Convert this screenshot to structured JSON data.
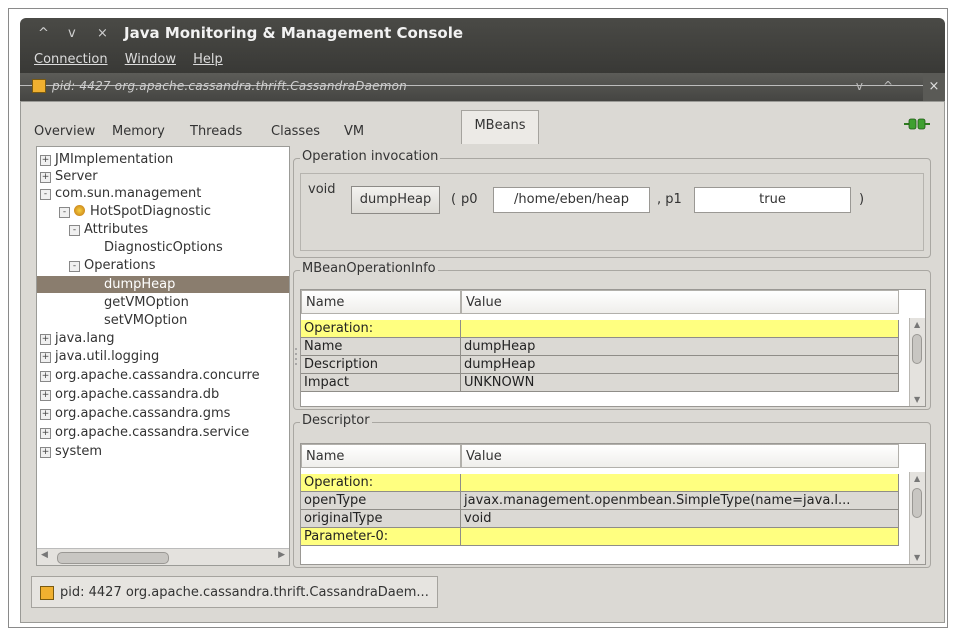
{
  "window": {
    "title": "Java Monitoring & Management Console",
    "controls": [
      "^",
      "v",
      "×"
    ],
    "menu": [
      "Connection",
      "Window",
      "Help"
    ]
  },
  "internal_frame": {
    "title": "pid: 4427 org.apache.cassandra.thrift.CassandraDaemon",
    "controls": [
      "v",
      "^",
      "×"
    ]
  },
  "tabs": [
    "Overview",
    "Memory",
    "Threads",
    "Classes",
    "VM Summary",
    "MBeans"
  ],
  "active_tab": "MBeans",
  "tree": [
    {
      "label": "JMImplementation",
      "expander": "+"
    },
    {
      "label": "Server",
      "expander": "+"
    },
    {
      "label": "com.sun.management",
      "expander": "-"
    },
    {
      "label": "HotSpotDiagnostic",
      "expander": "-"
    },
    {
      "label": "Attributes",
      "expander": "-"
    },
    {
      "label": "DiagnosticOptions",
      "expander": ""
    },
    {
      "label": "Operations",
      "expander": "-"
    },
    {
      "label": "dumpHeap",
      "expander": ""
    },
    {
      "label": "getVMOption",
      "expander": ""
    },
    {
      "label": "setVMOption",
      "expander": ""
    },
    {
      "label": "java.lang",
      "expander": "+"
    },
    {
      "label": "java.util.logging",
      "expander": "+"
    },
    {
      "label": "org.apache.cassandra.concurre",
      "expander": "+"
    },
    {
      "label": "org.apache.cassandra.db",
      "expander": "+"
    },
    {
      "label": "org.apache.cassandra.gms",
      "expander": "+"
    },
    {
      "label": "org.apache.cassandra.service",
      "expander": "+"
    },
    {
      "label": "system",
      "expander": "+"
    }
  ],
  "operation_invocation": {
    "title": "Operation invocation",
    "return_type": "void",
    "method_button": "dumpHeap",
    "open_paren": "(",
    "p0_label": "p0",
    "p0_value": "/home/eben/heap",
    "comma_p1": ", p1",
    "p1_value": "true",
    "close_paren": ")"
  },
  "mbean_info": {
    "title": "MBeanOperationInfo",
    "headers": [
      "Name",
      "Value"
    ],
    "rows": [
      {
        "name": "Operation:",
        "value": "",
        "style": "yellow"
      },
      {
        "name": "Name",
        "value": "dumpHeap",
        "style": "gray"
      },
      {
        "name": "Description",
        "value": "dumpHeap",
        "style": "gray"
      },
      {
        "name": "Impact",
        "value": "UNKNOWN",
        "style": "gray"
      }
    ]
  },
  "descriptor": {
    "title": "Descriptor",
    "headers": [
      "Name",
      "Value"
    ],
    "rows": [
      {
        "name": "Operation:",
        "value": "",
        "style": "yellow"
      },
      {
        "name": "openType",
        "value": "javax.management.openmbean.SimpleType(name=java.l...",
        "style": "gray"
      },
      {
        "name": "originalType",
        "value": "void",
        "style": "gray"
      },
      {
        "name": "Parameter-0:",
        "value": "",
        "style": "yellow"
      }
    ]
  },
  "status_bar": {
    "label": "pid: 4427 org.apache.cassandra.thrift.CassandraDaem..."
  },
  "colors": {
    "titlebar": "#3f3f3c",
    "selection": "#8a7d6e",
    "highlight_row": "#ffff80",
    "panel": "#dbd9d4"
  }
}
